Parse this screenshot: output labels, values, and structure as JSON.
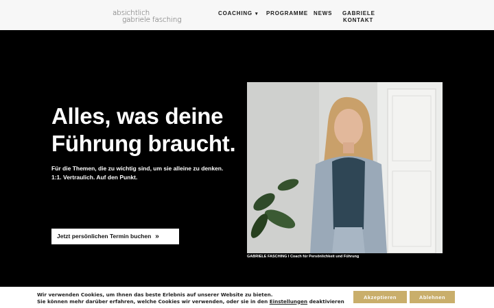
{
  "logo": {
    "line1": "absichtlich",
    "line2": "gabriele fasching"
  },
  "nav": {
    "coaching": "COACHING",
    "programme": "PROGRAMME",
    "news": "NEWS",
    "gabriele": "GABRIELE",
    "kontakt": "KONTAKT"
  },
  "hero": {
    "headline_line1": "Alles, was deine",
    "headline_line2": "Führung braucht.",
    "sub_line1": "Für die Themen, die zu wichtig sind, um sie alleine zu denken.",
    "sub_line2": "1:1. Vertraulich. Auf den Punkt.",
    "cta_label": "Jetzt persönlichen Termin buchen",
    "photo_caption": "GABRIELE FASCHING I Coach für Persönlichkeit und Führung"
  },
  "cookie": {
    "line1": "Wir verwenden Cookies, um Ihnen das beste Erlebnis auf unserer Website zu bieten.",
    "line2_before": "Sie können mehr darüber erfahren, welche Cookies wir verwenden, oder sie in den",
    "settings_link": "Einstellungen",
    "line2_after": "deaktivieren",
    "accept": "Akzeptieren",
    "reject": "Ablehnen"
  },
  "colors": {
    "accent_gold": "#c9ae6b",
    "hero_bg": "#000000",
    "header_bg": "#f7f7f7"
  }
}
